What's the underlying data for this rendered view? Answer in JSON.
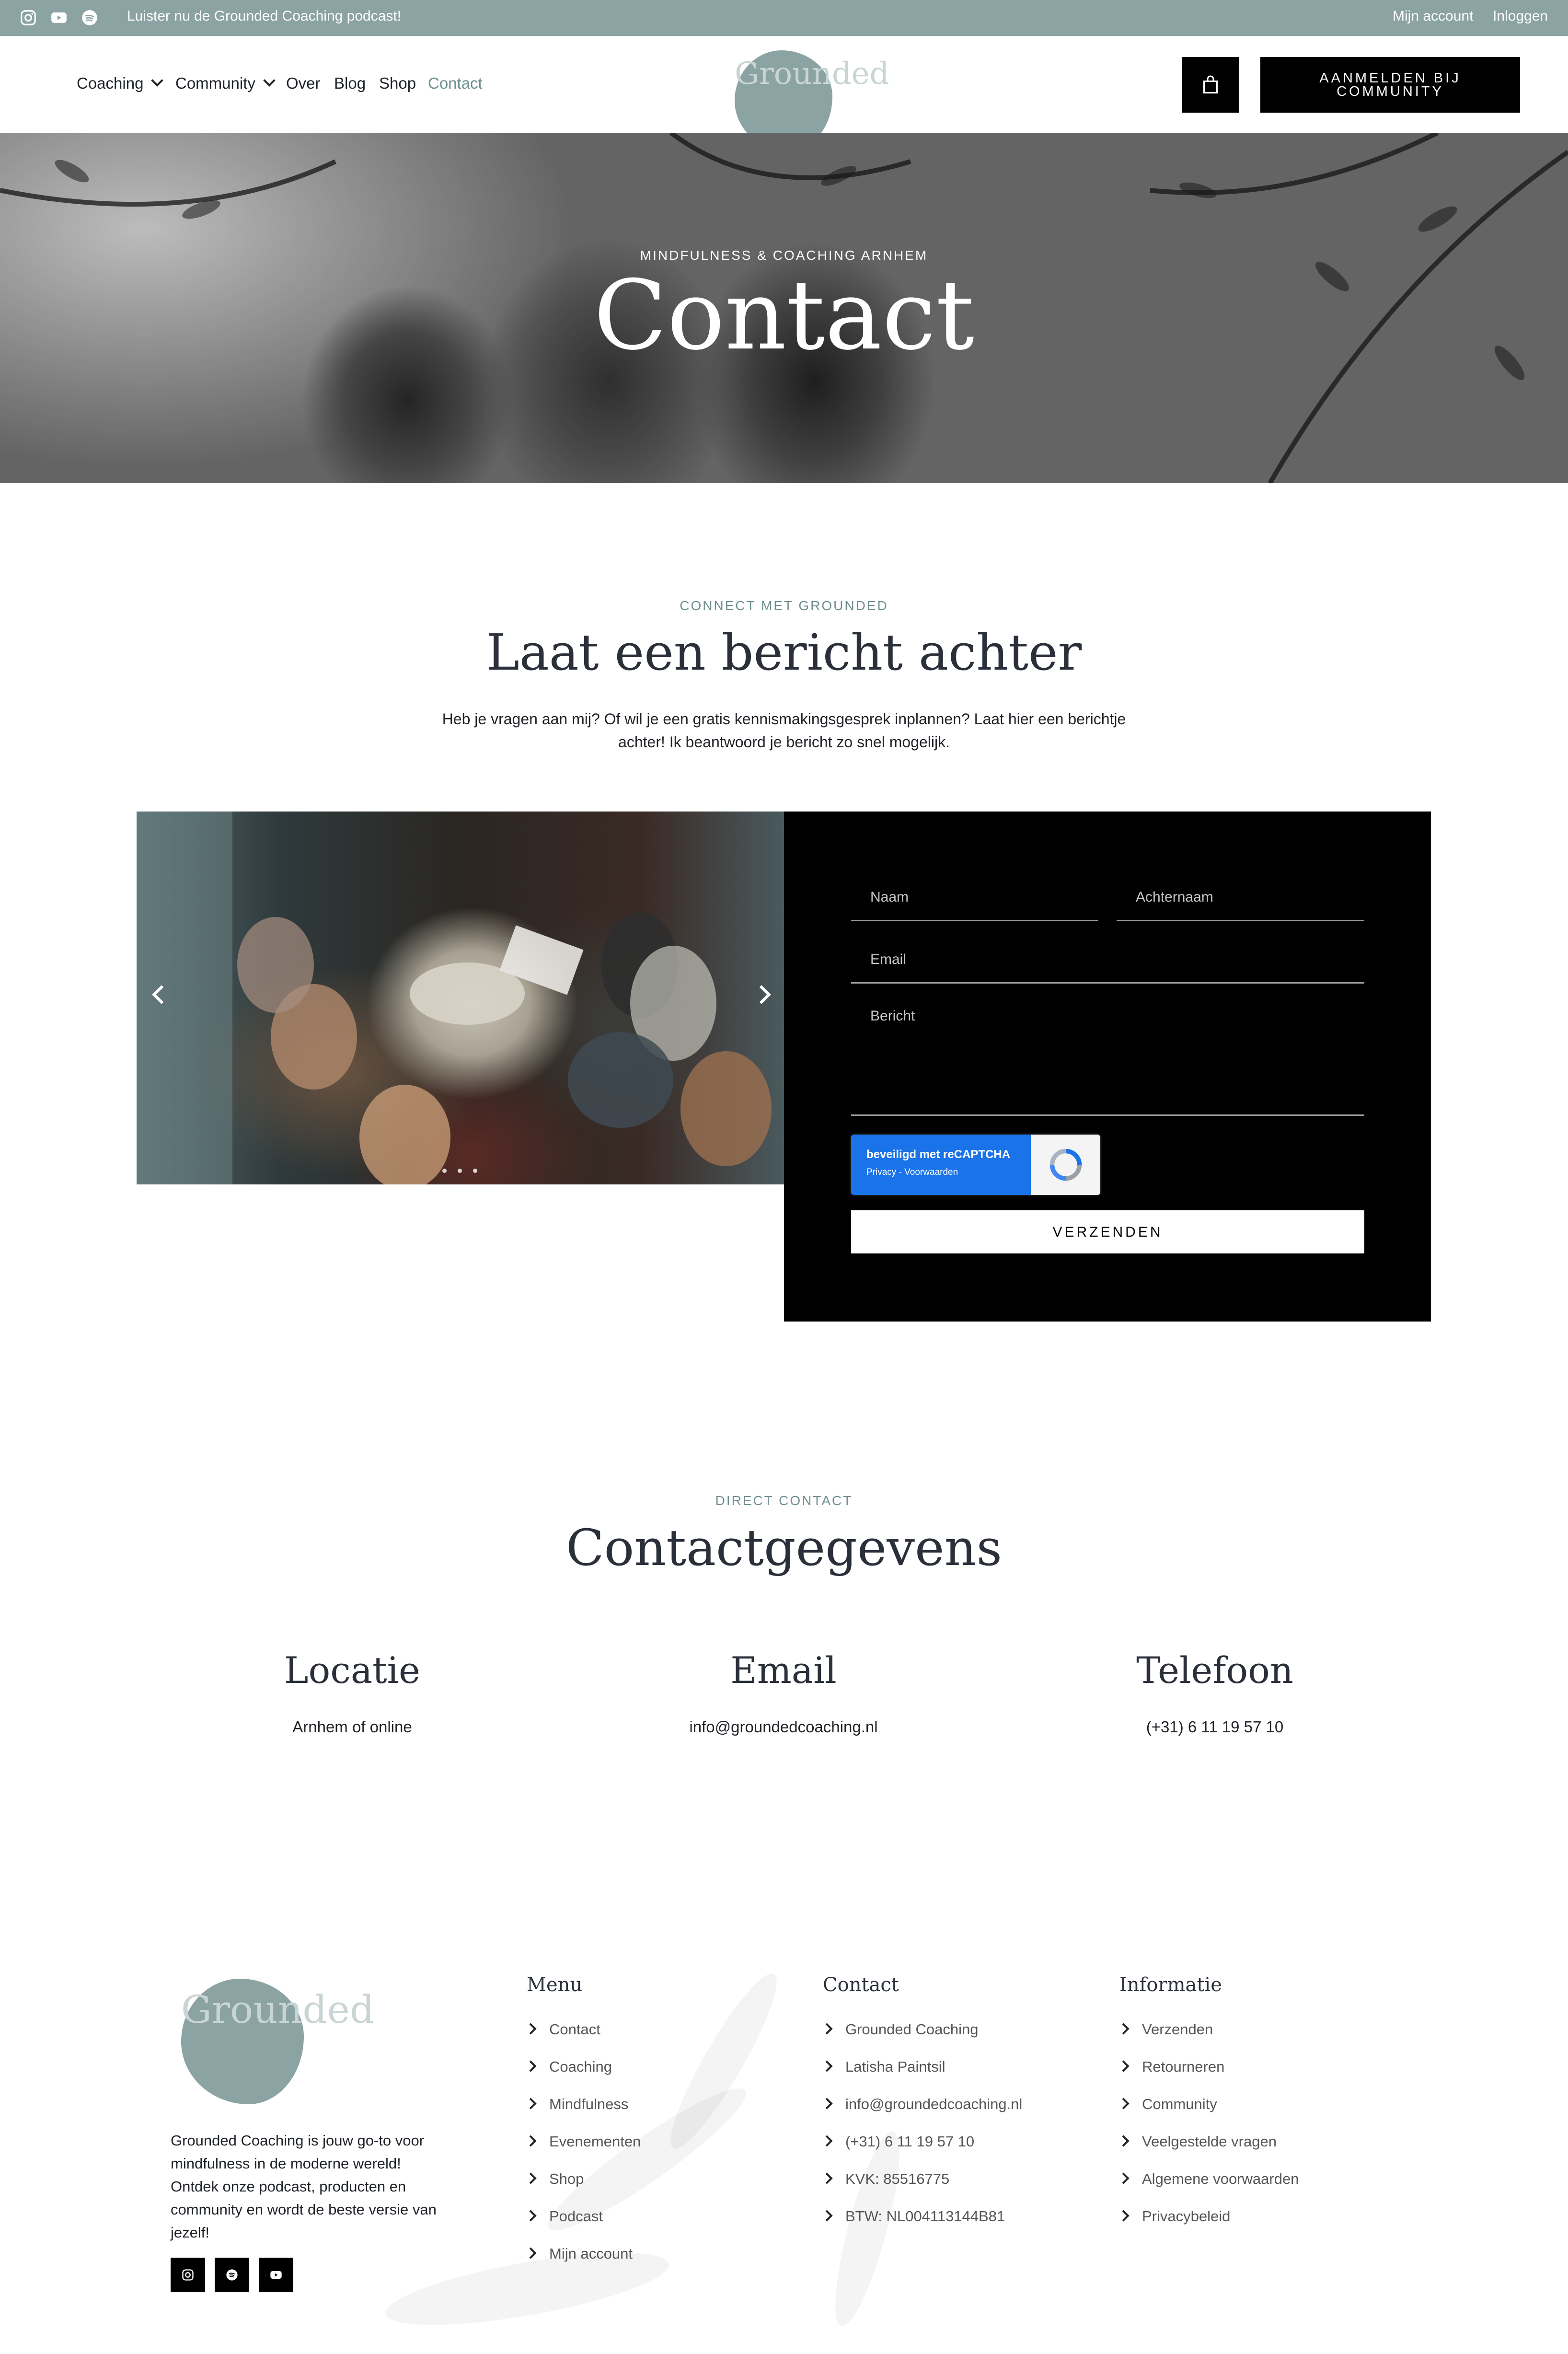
{
  "topbar": {
    "promo": "Luister nu de Grounded Coaching podcast!",
    "account": "Mijn account",
    "login": "Inloggen",
    "social_icons": [
      "instagram-icon",
      "youtube-icon",
      "spotify-icon"
    ]
  },
  "nav": {
    "items": [
      {
        "label": "Coaching",
        "dropdown": true
      },
      {
        "label": "Community",
        "dropdown": true
      },
      {
        "label": "Over"
      },
      {
        "label": "Blog"
      },
      {
        "label": "Shop"
      },
      {
        "label": "Contact",
        "active": true
      }
    ],
    "logo_text": "Grounded",
    "cta": "AANMELDEN BIJ COMMUNITY",
    "cart_icon": "shopping-bag-icon"
  },
  "hero": {
    "eyebrow": "MINDFULNESS & COACHING ARNHEM",
    "title": "Contact"
  },
  "message_section": {
    "eyebrow": "CONNECT MET GROUNDED",
    "title": "Laat een bericht achter",
    "intro": "Heb je vragen aan mij? Of wil je een gratis kennismakingsgesprek inplannen? Laat hier een berichtje achter! Ik beantwoord je bericht zo snel mogelijk."
  },
  "form": {
    "first_name_placeholder": "Naam",
    "last_name_placeholder": "Achternaam",
    "email_placeholder": "Email",
    "message_placeholder": "Bericht",
    "captcha_label": "beveiligd met reCAPTCHA",
    "captcha_links": "Privacy - Voorwaarden",
    "submit": "VERZENDEN"
  },
  "details_section": {
    "eyebrow": "DIRECT CONTACT",
    "title": "Contactgegevens",
    "columns": [
      {
        "heading": "Locatie",
        "value": "Arnhem of online"
      },
      {
        "heading": "Email",
        "value": "info@groundedcoaching.nl"
      },
      {
        "heading": "Telefoon",
        "value": "(+31) 6 11 19 57 10"
      }
    ]
  },
  "footer": {
    "logo_text": "Grounded",
    "about": "Grounded Coaching is jouw go-to voor mindfulness in de moderne wereld! Ontdek onze podcast, producten en community en wordt de beste versie van jezelf!",
    "menu": {
      "heading": "Menu",
      "links": [
        "Contact",
        "Coaching",
        "Mindfulness",
        "Evenementen",
        "Shop",
        "Podcast",
        "Mijn account"
      ]
    },
    "contact": {
      "heading": "Contact",
      "links": [
        "Grounded Coaching",
        "Latisha Paintsil",
        "info@groundedcoaching.nl",
        "(+31) 6 11 19 57 10",
        "KVK: 85516775",
        "BTW: NL004113144B81"
      ]
    },
    "info": {
      "heading": "Informatie",
      "links": [
        "Verzenden",
        "Retourneren",
        "Community",
        "Veelgestelde vragen",
        "Algemene voorwaarden",
        "Privacybeleid"
      ]
    }
  },
  "colors": {
    "accent": "#8ba3a2",
    "accent_text": "#6f8f8e",
    "dark": "#000000",
    "heading": "#2a2f3a"
  }
}
